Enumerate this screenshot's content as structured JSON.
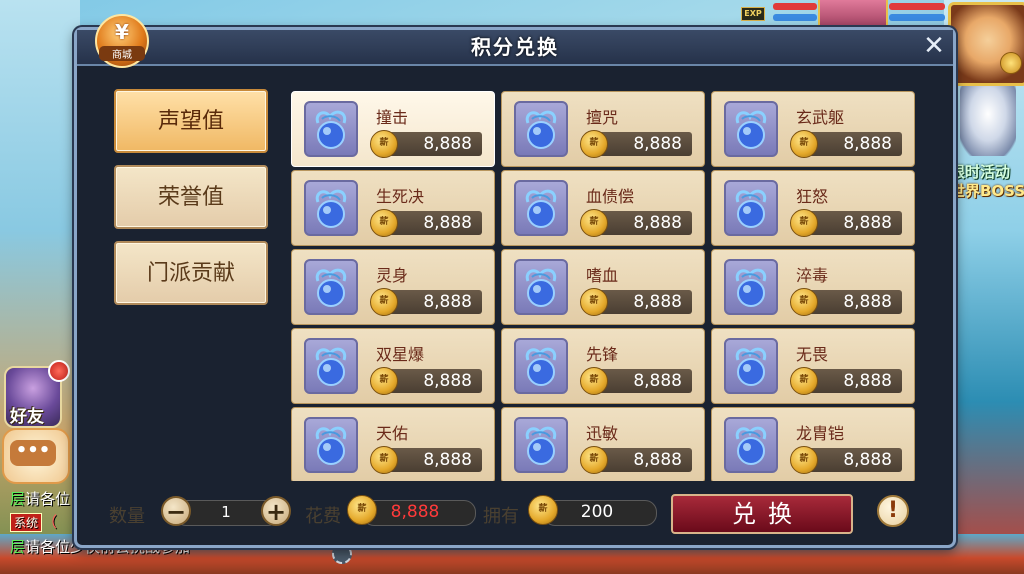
{
  "hud": {
    "exp_label": "EXP",
    "event_line1": "限时活动",
    "event_line2": "世界BOSS",
    "friend_label": "好友"
  },
  "chat": {
    "line1_tag": "层",
    "line1_text": "请各位",
    "line2_tag": "系统",
    "line2_text": "（",
    "line3_tag": "层",
    "line3_text": "请各位少侠前去挑战参加"
  },
  "panel": {
    "title": "积分兑换",
    "shop_glyph": "¥",
    "shop_label": "商城",
    "close": "✕"
  },
  "tabs": [
    {
      "label": "声望值",
      "active": true
    },
    {
      "label": "荣誉值",
      "active": false
    },
    {
      "label": "门派贡献",
      "active": false
    }
  ],
  "coin_glyph": "薪",
  "items": [
    {
      "name": "撞击",
      "price": "8,888"
    },
    {
      "name": "擅咒",
      "price": "8,888"
    },
    {
      "name": "玄武躯",
      "price": "8,888"
    },
    {
      "name": "生死决",
      "price": "8,888"
    },
    {
      "name": "血债偿",
      "price": "8,888"
    },
    {
      "name": "狂怒",
      "price": "8,888"
    },
    {
      "name": "灵身",
      "price": "8,888"
    },
    {
      "name": "嗜血",
      "price": "8,888"
    },
    {
      "name": "淬毒",
      "price": "8,888"
    },
    {
      "name": "双星爆",
      "price": "8,888"
    },
    {
      "name": "先锋",
      "price": "8,888"
    },
    {
      "name": "无畏",
      "price": "8,888"
    },
    {
      "name": "天佑",
      "price": "8,888"
    },
    {
      "name": "迅敏",
      "price": "8,888"
    },
    {
      "name": "龙胄铠",
      "price": "8,888"
    }
  ],
  "bottom": {
    "qty_label": "数量",
    "qty_value": "1",
    "minus": "−",
    "plus": "+",
    "cost_label": "花费",
    "cost_value": "8,888",
    "own_label": "拥有",
    "own_value": "200",
    "exchange_label": "兑换",
    "info": "!"
  },
  "colors": {
    "cost_value": "#ff3a3a",
    "accent_button": "#8a1a2a"
  }
}
